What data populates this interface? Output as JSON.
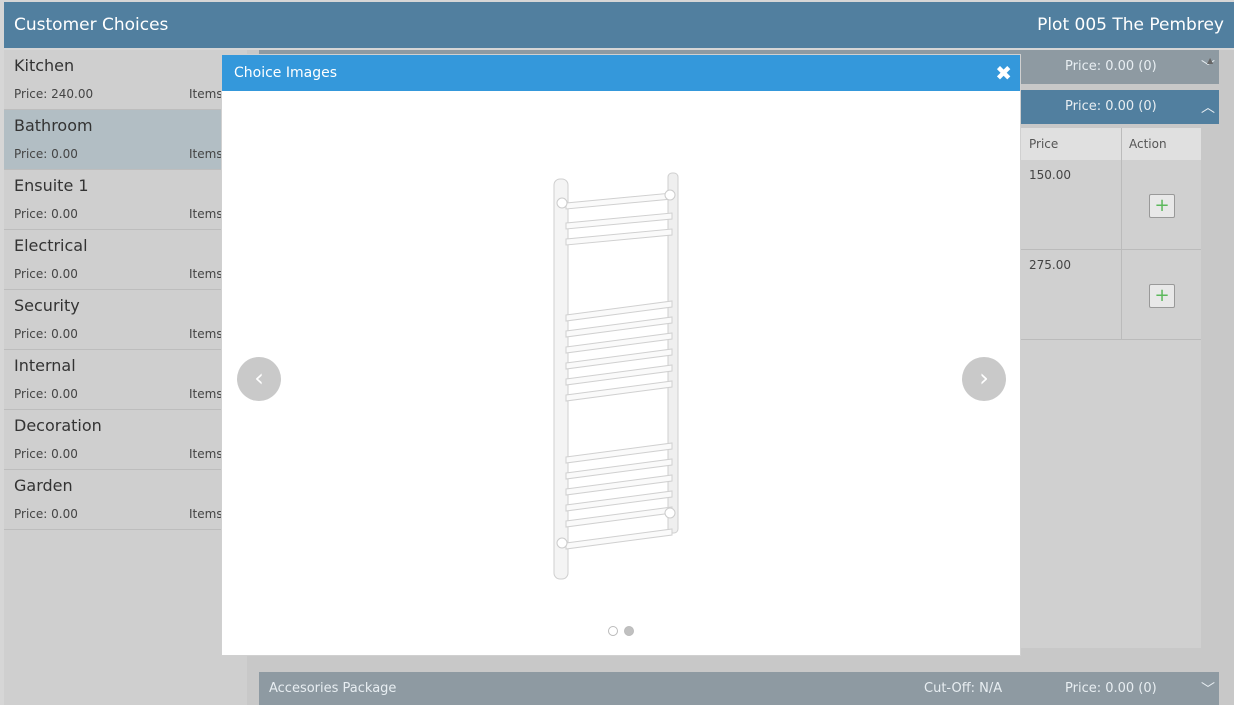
{
  "header": {
    "title": "Customer Choices",
    "plot": "Plot 005 The Pembrey"
  },
  "sidebar": {
    "items": [
      {
        "name": "Kitchen",
        "price": "Price: 240.00",
        "items": "Items"
      },
      {
        "name": "Bathroom",
        "price": "Price: 0.00",
        "items": "Items"
      },
      {
        "name": "Ensuite 1",
        "price": "Price: 0.00",
        "items": "Items"
      },
      {
        "name": "Electrical",
        "price": "Price: 0.00",
        "items": "Items"
      },
      {
        "name": "Security",
        "price": "Price: 0.00",
        "items": "Items"
      },
      {
        "name": "Internal",
        "price": "Price: 0.00",
        "items": "Items"
      },
      {
        "name": "Decoration",
        "price": "Price: 0.00",
        "items": "Items"
      },
      {
        "name": "Garden",
        "price": "Price: 0.00",
        "items": "Items"
      }
    ]
  },
  "main": {
    "bar1_price": "Price: 0.00 (0)",
    "bar2_price": "Price: 0.00 (0)",
    "table": {
      "col_price": "Price",
      "col_action": "Action",
      "rows": [
        {
          "price": "150.00",
          "action": "+"
        },
        {
          "price": "275.00",
          "action": "+"
        }
      ]
    },
    "footer_bar": {
      "label": "Accesories Package",
      "cutoff": "Cut-Off: N/A",
      "price": "Price: 0.00 (0)"
    }
  },
  "modal": {
    "title": "Choice Images",
    "close": "✖",
    "prev": "‹",
    "next": "›",
    "product_icon": "heated-towel-rail"
  },
  "colors": {
    "header": "#517f9f",
    "modal_header": "#3498db",
    "active_item": "#b2bec4",
    "add_icon": "#5cb85c"
  }
}
